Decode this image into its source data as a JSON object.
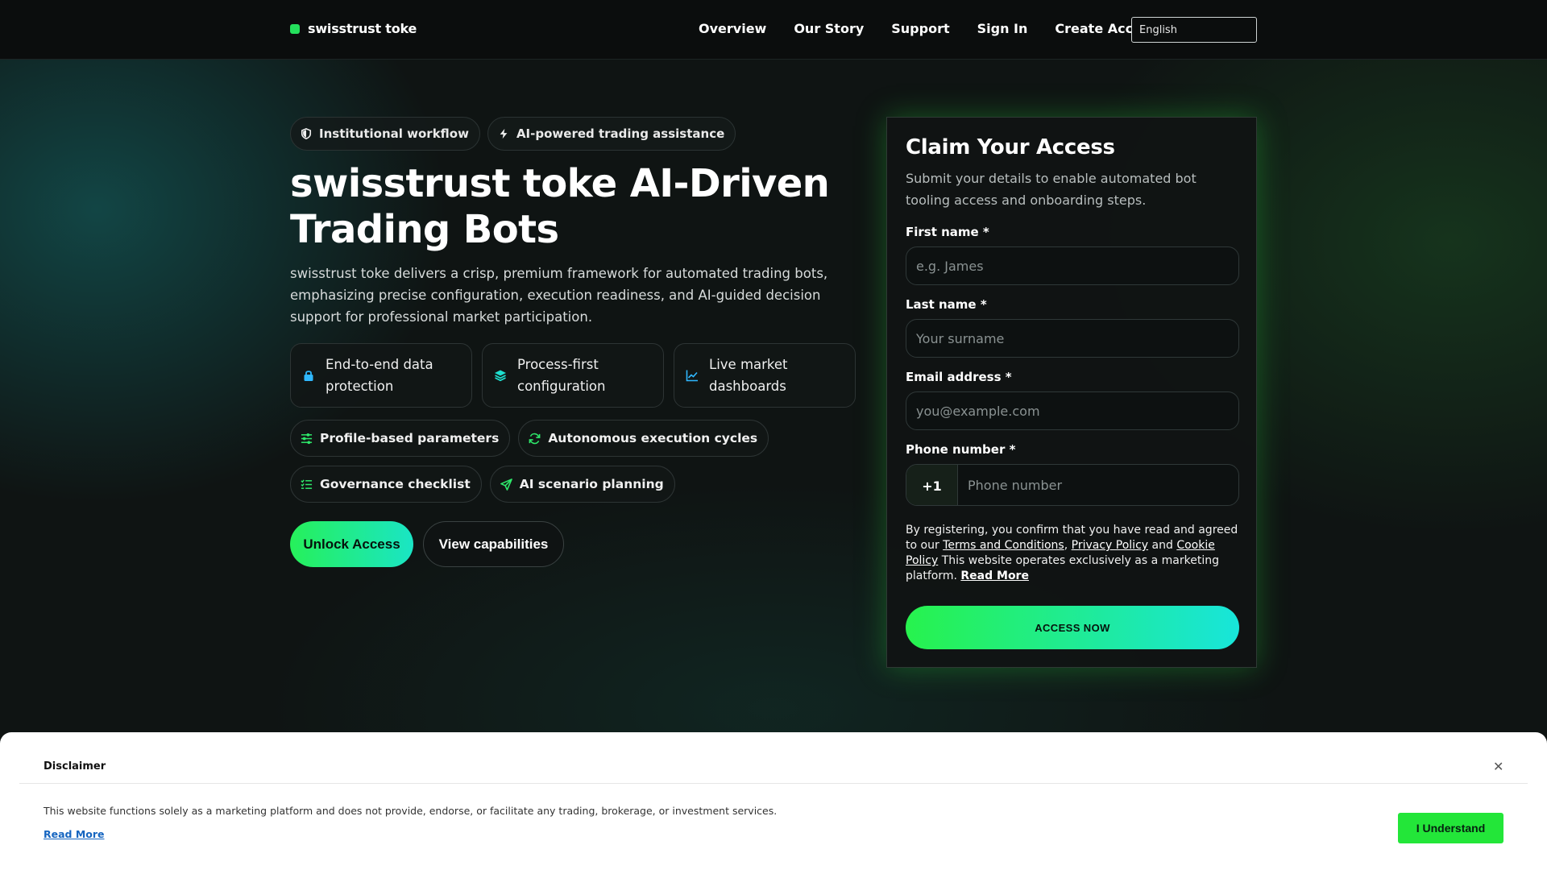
{
  "header": {
    "brand": "swisstrust toke",
    "nav": [
      "Overview",
      "Our Story",
      "Support",
      "Sign In",
      "Create Account"
    ],
    "language": "English"
  },
  "hero": {
    "chips": [
      "Institutional workflow",
      "AI-powered trading assistance"
    ],
    "title": "swisstrust toke AI-Driven Trading Bots",
    "lead": "swisstrust toke delivers a crisp, premium framework for automated trading bots, emphasizing precise configuration, execution readiness, and AI-guided decision support for professional market participation.",
    "features": [
      "End-to-end data protection",
      "Process-first configuration",
      "Live market dashboards"
    ],
    "pills": [
      "Profile-based parameters",
      "Autonomous execution cycles",
      "Governance checklist",
      "AI scenario planning"
    ],
    "cta_primary": "Unlock Access",
    "cta_secondary": "View capabilities"
  },
  "form": {
    "title": "Claim Your Access",
    "subtitle": "Submit your details to enable automated bot tooling access and onboarding steps.",
    "first_name_label": "First name *",
    "first_name_placeholder": "e.g. James",
    "last_name_label": "Last name *",
    "last_name_placeholder": "Your surname",
    "email_label": "Email address *",
    "email_placeholder": "you@example.com",
    "phone_label": "Phone number *",
    "phone_code": "+1",
    "phone_placeholder": "Phone number",
    "legal_intro": "By registering, you confirm that you have read and agreed to our",
    "terms": "Terms and Conditions",
    "privacy": "Privacy Policy",
    "and": "and",
    "cookie": "Cookie Policy",
    "legal_outro": "This website operates exclusively as a marketing platform.",
    "read_more": "Read More",
    "submit": "ACCESS NOW"
  },
  "disclaimer": {
    "title": "Disclaimer",
    "text": "This website functions solely as a marketing platform and does not provide, endorse, or facilitate any trading, brokerage, or investment services.",
    "read_more": "Read More",
    "button": "I Understand"
  },
  "colors": {
    "accent_green": "#24e05c",
    "accent_cyan": "#1ae5c5",
    "background": "#0f1413"
  }
}
